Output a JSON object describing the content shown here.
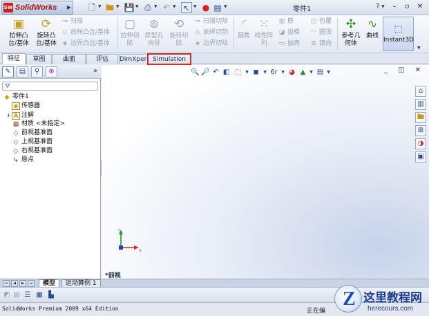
{
  "app": {
    "name": "SolidWorks",
    "logo_badge": "SW",
    "document_title": "零件1"
  },
  "window_controls": {
    "help": "?",
    "minimize": "–",
    "restore": "▫",
    "close": "✕"
  },
  "ribbon": {
    "features": [
      {
        "label": "拉伸凸\n台/基体",
        "enabled": true,
        "icon": "extrude-boss-icon"
      },
      {
        "label": "旋转凸\n台/基体",
        "enabled": true,
        "icon": "revolve-boss-icon"
      }
    ],
    "boss_small": [
      "扫描",
      "放样凸台/基体",
      "边界凸台/基体"
    ],
    "cut_big": [
      {
        "label": "拉伸切\n除",
        "enabled": false
      },
      {
        "label": "异型孔\n向导",
        "enabled": false
      },
      {
        "label": "旋转切\n除",
        "enabled": false
      }
    ],
    "cut_small": [
      "扫描切除",
      "放样切割",
      "边界切除"
    ],
    "fillet": "圆角",
    "pattern": "线性阵\n列",
    "mid_small_a": [
      "筋",
      "拔模",
      "抽壳"
    ],
    "mid_small_b": [
      "包覆",
      "圆顶",
      "镜向"
    ],
    "ref_geometry": "参考几\n何体",
    "curves": "曲线",
    "instant3d": "Instant3D"
  },
  "command_tabs": [
    {
      "label": "特征",
      "active": true
    },
    {
      "label": "草图",
      "active": false
    },
    {
      "label": "曲面",
      "active": false
    },
    {
      "label": "评估",
      "active": false
    },
    {
      "label": "DimXpert",
      "active": false
    },
    {
      "label": "Simulation",
      "active": false,
      "highlighted": true
    }
  ],
  "feature_tree": {
    "root": "零件1",
    "items": [
      {
        "label": "传感器",
        "icon": "sensor-icon",
        "expandable": false
      },
      {
        "label": "注解",
        "icon": "annotation-icon",
        "expandable": true
      },
      {
        "label": "材质 <未指定>",
        "icon": "material-icon",
        "expandable": false
      },
      {
        "label": "前视基准面",
        "icon": "plane-icon",
        "expandable": false
      },
      {
        "label": "上视基准面",
        "icon": "plane-icon",
        "expandable": false
      },
      {
        "label": "右视基准面",
        "icon": "plane-icon",
        "expandable": false
      },
      {
        "label": "原点",
        "icon": "origin-icon",
        "expandable": false
      }
    ]
  },
  "graphics": {
    "view_label": "*前视",
    "triad": {
      "x": "X",
      "y": "Y"
    }
  },
  "model_tabs": [
    {
      "label": "模型",
      "active": true
    },
    {
      "label": "运动算例 1",
      "active": false
    }
  ],
  "status": {
    "left": "SolidWorks Premium 2009 x64 Edition",
    "right": "正在编"
  },
  "watermark": {
    "title": "这里教程网",
    "url": "herecours.com"
  }
}
